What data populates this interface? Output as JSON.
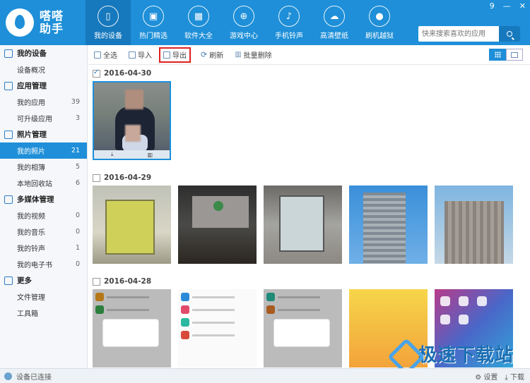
{
  "app": {
    "name": "嗒嗒助手"
  },
  "nav": [
    {
      "label": "我的设备",
      "icon": "phone-icon",
      "active": true
    },
    {
      "label": "热门精选",
      "icon": "gift-icon"
    },
    {
      "label": "软件大全",
      "icon": "grid-icon"
    },
    {
      "label": "游戏中心",
      "icon": "gamepad-icon"
    },
    {
      "label": "手机铃声",
      "icon": "bell-icon"
    },
    {
      "label": "高清壁纸",
      "icon": "wallpaper-icon"
    },
    {
      "label": "刷机越狱",
      "icon": "apple-icon"
    }
  ],
  "window": {
    "badge": "9",
    "minimize": "—",
    "close": "✕"
  },
  "search": {
    "placeholder": "快来搜索喜欢的应用"
  },
  "sidebar": {
    "sections": [
      {
        "title": "我的设备",
        "items": [
          {
            "label": "设备概况",
            "count": ""
          }
        ]
      },
      {
        "title": "应用管理",
        "items": [
          {
            "label": "我的应用",
            "count": "39"
          },
          {
            "label": "可升级应用",
            "count": "3"
          }
        ]
      },
      {
        "title": "照片管理",
        "items": [
          {
            "label": "我的照片",
            "count": "21",
            "active": true
          },
          {
            "label": "我的相簿",
            "count": "5"
          },
          {
            "label": "本地回收站",
            "count": "6"
          }
        ]
      },
      {
        "title": "多媒体管理",
        "items": [
          {
            "label": "我的视频",
            "count": "0"
          },
          {
            "label": "我的音乐",
            "count": "0"
          },
          {
            "label": "我的铃声",
            "count": "1"
          },
          {
            "label": "我的电子书",
            "count": "0"
          }
        ]
      },
      {
        "title": "更多",
        "items": [
          {
            "label": "文件管理",
            "count": ""
          },
          {
            "label": "工具箱",
            "count": ""
          }
        ]
      }
    ]
  },
  "toolbar": {
    "select_all": "全选",
    "import": "导入",
    "export": "导出",
    "refresh": "刷新",
    "batch_delete": "批量删除"
  },
  "groups": [
    {
      "date": "2016-04-30",
      "checked": true
    },
    {
      "date": "2016-04-29",
      "checked": false
    },
    {
      "date": "2016-04-28",
      "checked": false
    }
  ],
  "status": {
    "connection": "设备已连接",
    "settings": "设置",
    "download": "下载"
  },
  "watermark": {
    "text": "极速下载站"
  },
  "colors": {
    "brand": "#1e8fd8",
    "brand_dark": "#1678bd",
    "highlight": "#e02020"
  }
}
